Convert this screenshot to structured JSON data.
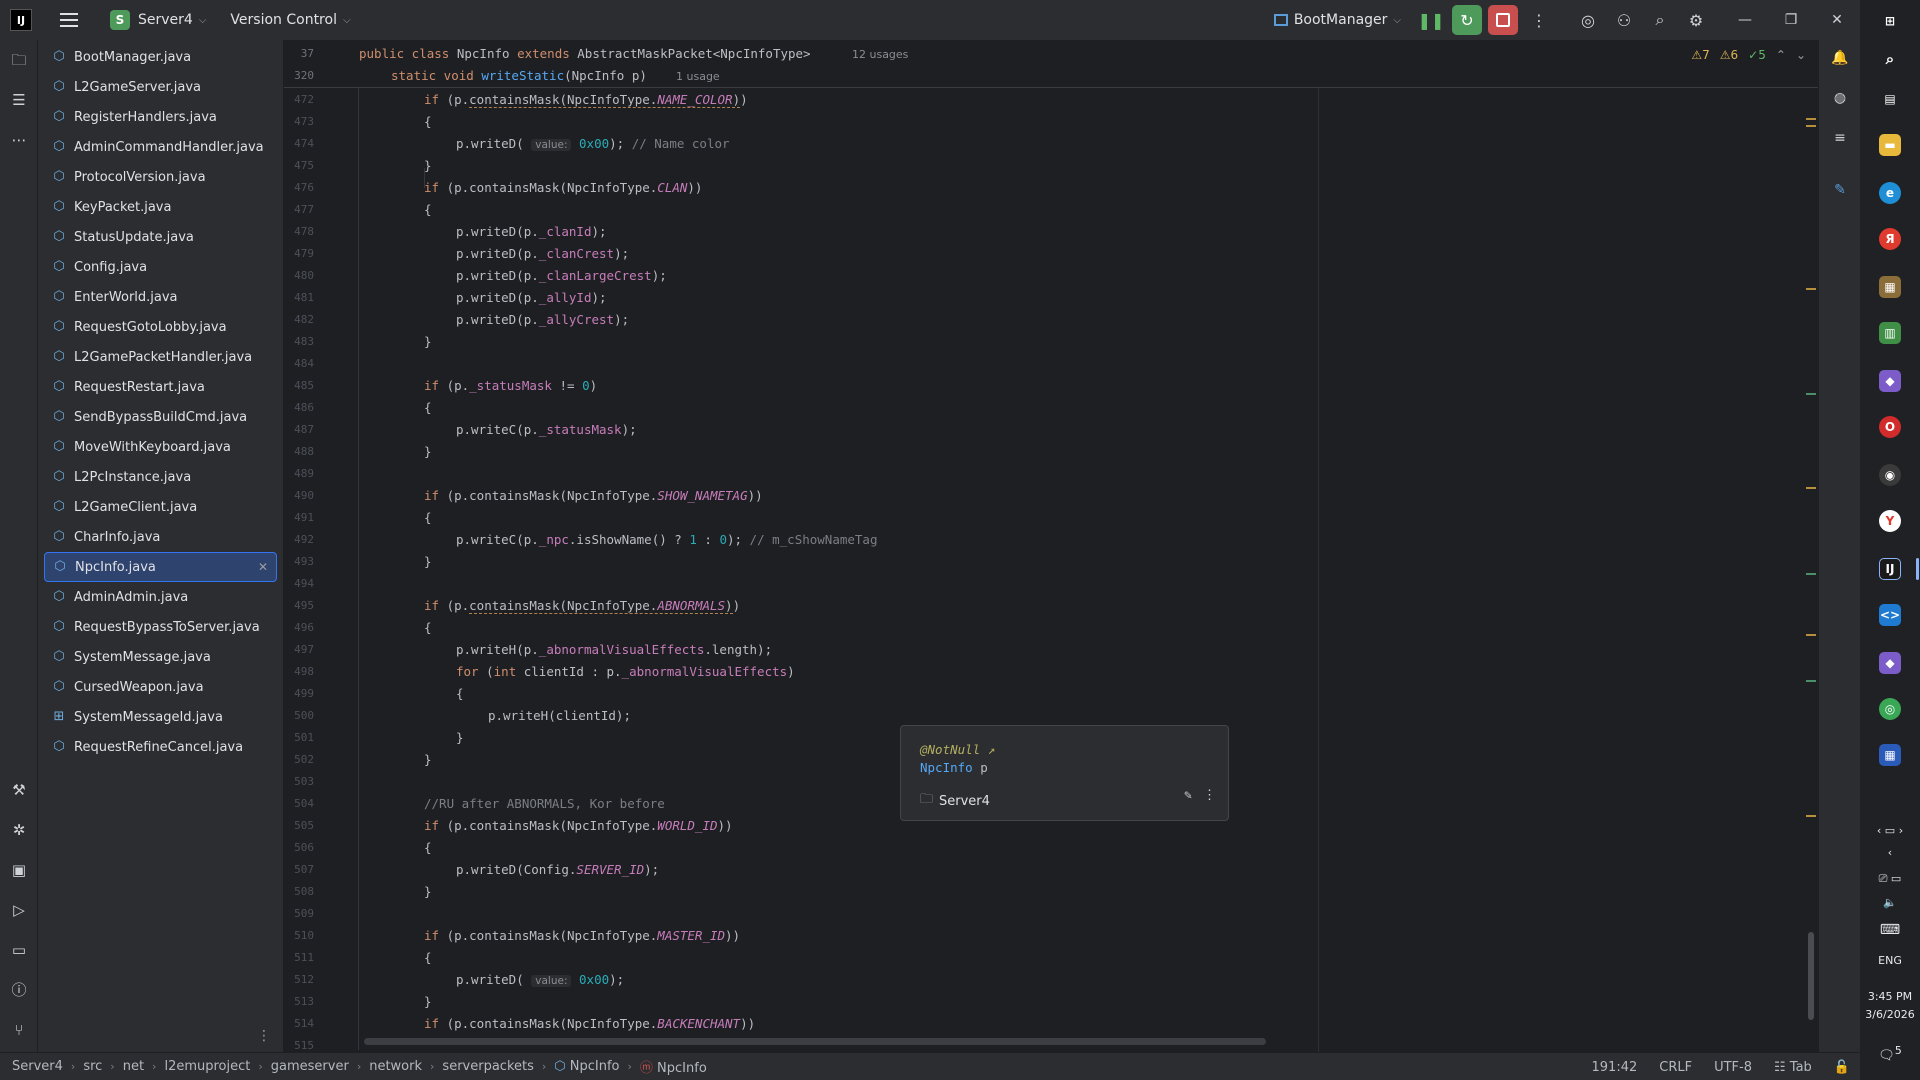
{
  "titlebar": {
    "project_letter": "S",
    "project_name": "Server4",
    "vcs_label": "Version Control",
    "run_config": "BootManager"
  },
  "file_tree": {
    "files": [
      {
        "name": "BootManager.java"
      },
      {
        "name": "L2GameServer.java"
      },
      {
        "name": "RegisterHandlers.java"
      },
      {
        "name": "AdminCommandHandler.java"
      },
      {
        "name": "ProtocolVersion.java"
      },
      {
        "name": "KeyPacket.java"
      },
      {
        "name": "StatusUpdate.java"
      },
      {
        "name": "Config.java"
      },
      {
        "name": "EnterWorld.java"
      },
      {
        "name": "RequestGotoLobby.java"
      },
      {
        "name": "L2GamePacketHandler.java"
      },
      {
        "name": "RequestRestart.java"
      },
      {
        "name": "SendBypassBuildCmd.java"
      },
      {
        "name": "MoveWithKeyboard.java"
      },
      {
        "name": "L2PcInstance.java"
      },
      {
        "name": "L2GameClient.java"
      },
      {
        "name": "CharInfo.java"
      },
      {
        "name": "NpcInfo.java",
        "selected": true
      },
      {
        "name": "AdminAdmin.java"
      },
      {
        "name": "RequestBypassToServer.java"
      },
      {
        "name": "SystemMessage.java"
      },
      {
        "name": "CursedWeapon.java"
      },
      {
        "name": "SystemMessageId.java"
      },
      {
        "name": "RequestRefineCancel.java"
      }
    ]
  },
  "editor": {
    "sticky": {
      "line1_no": "37",
      "line1_code": "public class NpcInfo extends AbstractMaskPacket<NpcInfoType>",
      "line1_usages": "12 usages",
      "line2_no": "320",
      "line2_code": "static void writeStatic(NpcInfo p)",
      "line2_usages": "1 usage"
    },
    "inspections": {
      "warnings": "7",
      "weak_warnings": "6",
      "ok": "5"
    },
    "param_hint_value": "value:",
    "line_numbers": [
      "472",
      "473",
      "474",
      "475",
      "476",
      "477",
      "478",
      "479",
      "480",
      "481",
      "482",
      "483",
      "484",
      "485",
      "486",
      "487",
      "488",
      "489",
      "490",
      "491",
      "492",
      "493",
      "494",
      "495",
      "496",
      "497",
      "498",
      "499",
      "500",
      "501",
      "502",
      "503",
      "504",
      "505",
      "506",
      "507",
      "508",
      "509",
      "510",
      "511",
      "512",
      "513",
      "514",
      "515"
    ]
  },
  "popup": {
    "annotation": "@NotNull",
    "type": "NpcInfo",
    "param": "p",
    "module": "Server4"
  },
  "statusbar": {
    "breadcrumbs": [
      "Server4",
      "src",
      "net",
      "l2emuproject",
      "gameserver",
      "network",
      "serverpackets",
      "NpcInfo",
      "NpcInfo"
    ],
    "position": "191:42",
    "line_sep": "CRLF",
    "encoding": "UTF-8",
    "indent": "Tab"
  },
  "taskbar": {
    "time": "3:45 PM",
    "date": "3/6/2026",
    "lang": "ENG",
    "notif_count": "5"
  },
  "colors": {
    "background": "#1e1f22",
    "panel": "#2b2d30",
    "accent_blue": "#3574f0",
    "run_green": "#4e9a5a",
    "stop_red": "#c94f4f",
    "keyword": "#cf8e6d",
    "field": "#c77dbb",
    "number": "#2aacb8"
  }
}
